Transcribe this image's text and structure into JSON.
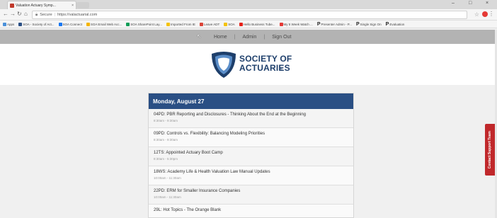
{
  "browser": {
    "tab_title": "Valuation Actuary Symp...",
    "tab_close": "×",
    "window_controls": [
      "–",
      "□",
      "×"
    ],
    "url_secure_label": "Secure",
    "url": "https://valactuarial.com",
    "nav_icons": [
      "back-arrow",
      "forward-arrow",
      "reload",
      "home"
    ],
    "bookmarks": [
      {
        "label": "Apps",
        "color": "#4a90d9"
      },
      {
        "label": "SOA - Society of Act...",
        "color": "#2a4f84"
      },
      {
        "label": "SOA Connect",
        "color": "#1877f2"
      },
      {
        "label": "SOA Email Web Acc...",
        "color": "#f4b400"
      },
      {
        "label": "SOA SharePoint Lay...",
        "color": "#0f9d58"
      },
      {
        "label": "Imported From IE",
        "color": "#f4c20d"
      },
      {
        "label": "Leave ADT",
        "color": "#db4437"
      },
      {
        "label": "SOA",
        "color": "#f4c20d"
      },
      {
        "label": "Hello Business Tube...",
        "color": "#e62117"
      },
      {
        "label": "My 5 Week Watch ...",
        "color": "#e53935"
      }
    ],
    "bookmarks_p": [
      {
        "label": "Presenter Admin - P..."
      },
      {
        "label": "Single Sign On"
      },
      {
        "label": "Evaluation"
      }
    ]
  },
  "site_nav": {
    "links": [
      "Home",
      "Admin",
      "Sign Out"
    ]
  },
  "logo": {
    "line1": "SOCIETY OF",
    "line2": "ACTUARIES",
    "mark": "®",
    "colors": {
      "outer": "#1e3f6b",
      "inner": "#5b8ec9"
    }
  },
  "schedule": {
    "day": "Monday, August 27",
    "header_color": "#2a4f84",
    "sessions": [
      {
        "title": "04PD: PBR Reporting and Disclosures - Thinking About the End at the Beginning",
        "time": "8:30am - 9:30am"
      },
      {
        "title": "09PD: Controls vs. Flexibility: Balancing Modeling Priorities",
        "time": "8:30am - 9:30am"
      },
      {
        "title": "12TS: Appointed Actuary Boot Camp",
        "time": "8:30am - 5:30pm"
      },
      {
        "title": "18WS: Academy Life & Health Valuation Law Manual Updates",
        "time": "10:00am - 11:30am"
      },
      {
        "title": "22PD: ERM for Smaller Insurance Companies",
        "time": "10:00am - 11:30am"
      },
      {
        "title": "29L: Hot Topics - The Orange Blank",
        "time": ""
      }
    ]
  },
  "support_tab": {
    "label": "Contact Support Team",
    "color": "#c0282b"
  }
}
